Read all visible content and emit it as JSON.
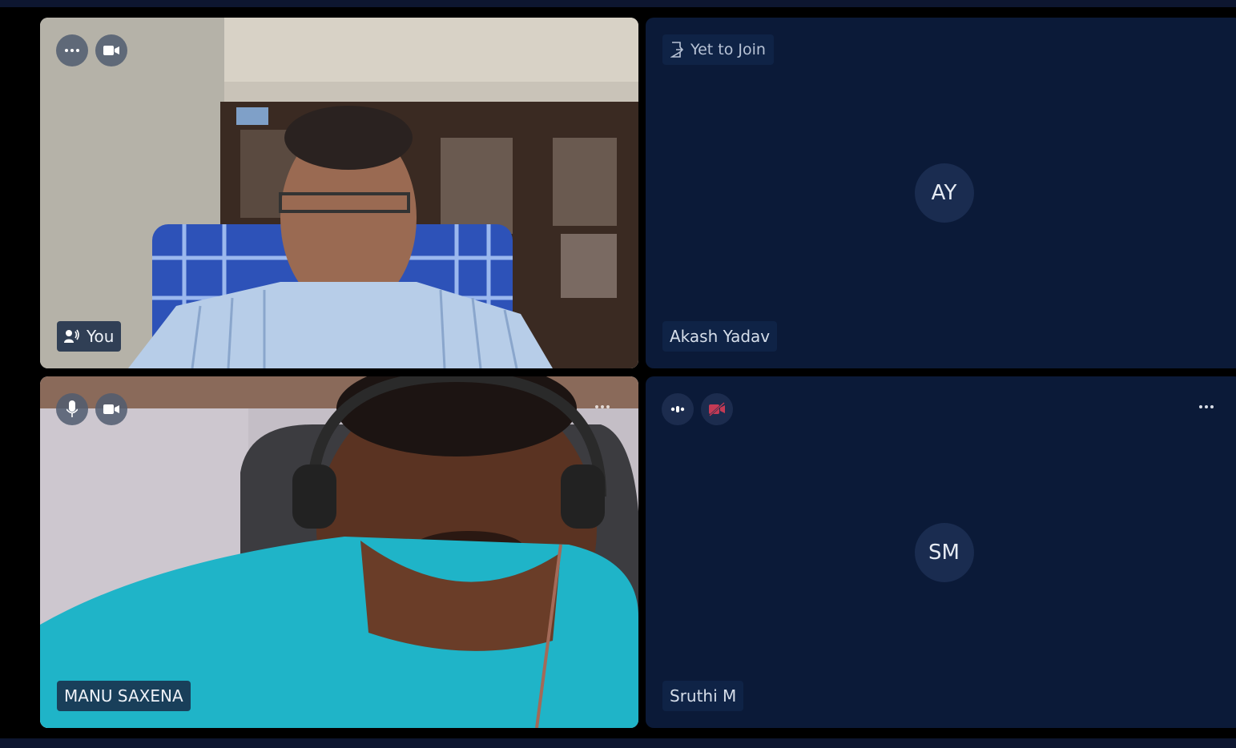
{
  "colors": {
    "page_background": "#000000",
    "frame_bar": "#0d1630",
    "dark_tile": "#0b1a38",
    "avatar_circle": "#1a2c50",
    "muted_video_icon": "#c43a55"
  },
  "tiles": [
    {
      "name": "You",
      "controls": [
        "more-options-icon",
        "video-camera-icon"
      ],
      "label_icon": "speaking-user-icon",
      "type": "video"
    },
    {
      "name": "Akash Yadav",
      "status": "Yet to Join",
      "status_icon": "exit-door-icon",
      "initials": "AY",
      "type": "avatar"
    },
    {
      "name": "MANU SAXENA",
      "controls": [
        "microphone-icon",
        "video-camera-icon"
      ],
      "more_icon": "more-options-icon",
      "type": "video"
    },
    {
      "name": "Sruthi M",
      "controls": [
        "audio-level-icon",
        "video-off-icon"
      ],
      "more_icon": "more-options-icon",
      "initials": "SM",
      "type": "avatar"
    }
  ]
}
